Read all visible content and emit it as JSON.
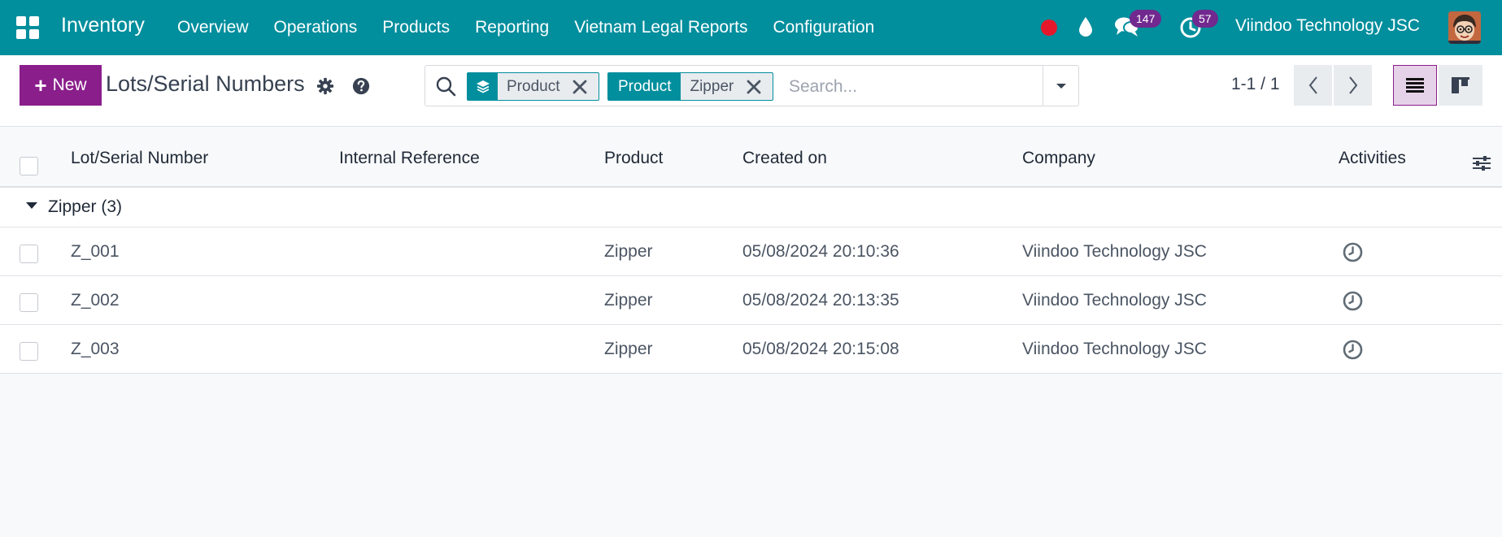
{
  "navbar": {
    "brand": "Inventory",
    "menu": [
      {
        "label": "Overview"
      },
      {
        "label": "Operations"
      },
      {
        "label": "Products"
      },
      {
        "label": "Reporting"
      },
      {
        "label": "Vietnam Legal Reports"
      },
      {
        "label": "Configuration"
      }
    ],
    "messages_count": "147",
    "activities_count": "57",
    "company": "Viindoo Technology JSC",
    "colors": {
      "bar": "#018e9d",
      "badge": "#71298f",
      "record": "#e5182b"
    }
  },
  "control_panel": {
    "new_label": "New",
    "title": "Lots/Serial Numbers",
    "search": {
      "facets": [
        {
          "label_icon": "layers-icon",
          "value": "Product"
        },
        {
          "label": "Product",
          "value": "Zipper"
        }
      ],
      "placeholder": "Search..."
    },
    "pager": "1-1 / 1",
    "accent": "#8a1e8b"
  },
  "table": {
    "columns": [
      "Lot/Serial Number",
      "Internal Reference",
      "Product",
      "Created on",
      "Company",
      "Activities"
    ],
    "group": {
      "label": "Zipper (3)"
    },
    "rows": [
      {
        "lot": "Z_001",
        "ref": "",
        "product": "Zipper",
        "created": "05/08/2024 20:10:36",
        "company": "Viindoo Technology JSC",
        "activity_icon": "clock-icon"
      },
      {
        "lot": "Z_002",
        "ref": "",
        "product": "Zipper",
        "created": "05/08/2024 20:13:35",
        "company": "Viindoo Technology JSC",
        "activity_icon": "clock-icon"
      },
      {
        "lot": "Z_003",
        "ref": "",
        "product": "Zipper",
        "created": "05/08/2024 20:15:08",
        "company": "Viindoo Technology JSC",
        "activity_icon": "clock-icon"
      }
    ]
  }
}
